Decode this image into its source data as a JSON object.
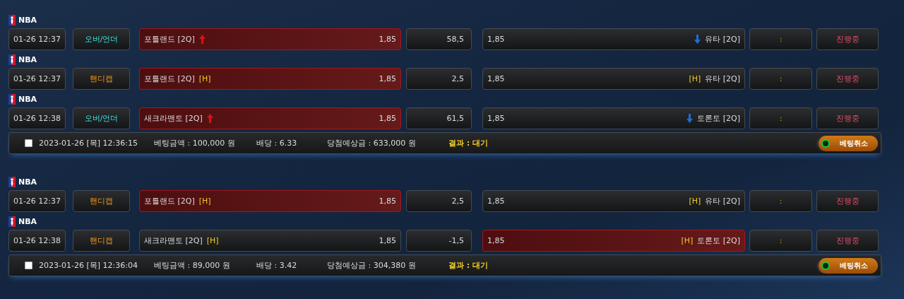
{
  "bets": [
    {
      "games": [
        {
          "league": "NBA",
          "time": "01-26 12:37",
          "type": {
            "kind": "over_under",
            "label": "오버/언더"
          },
          "home": {
            "kind": "rising",
            "name": "포틀랜드 [2Q]",
            "odds": "1,85",
            "selected": true
          },
          "line": "58,5",
          "away": {
            "kind": "falling",
            "odds": "1,85",
            "name": "유타 [2Q]",
            "selected": false
          },
          "score": ":",
          "status": "진행중"
        },
        {
          "league": "NBA",
          "time": "01-26 12:37",
          "type": {
            "kind": "handicap",
            "label": "핸디캡"
          },
          "home": {
            "name": "포틀랜드 [2Q]",
            "tag": "[H]",
            "odds": "1,85",
            "selected": true
          },
          "line": "2,5",
          "away": {
            "odds": "1,85",
            "tag": "[H]",
            "name": "유타 [2Q]",
            "selected": false
          },
          "score": ":",
          "status": "진행중"
        },
        {
          "league": "NBA",
          "time": "01-26 12:38",
          "type": {
            "kind": "over_under",
            "label": "오버/언더"
          },
          "home": {
            "kind": "rising",
            "name": "새크라맨토 [2Q]",
            "odds": "1,85",
            "selected": true
          },
          "line": "61,5",
          "away": {
            "kind": "falling",
            "odds": "1,85",
            "name": "토론토 [2Q]",
            "selected": false
          },
          "score": ":",
          "status": "진행중"
        }
      ],
      "summary": {
        "checked": false,
        "datetime": "2023-01-26 [목] 12:36:15",
        "amount": "베팅금액 : 100,000 원",
        "odds": "배당 : 6.33",
        "payout": "당첨예상금 : 633,000 원",
        "result": "결과 : 대기",
        "cancel": "베팅취소"
      }
    },
    {
      "games": [
        {
          "league": "NBA",
          "time": "01-26 12:37",
          "type": {
            "kind": "handicap",
            "label": "핸디캡"
          },
          "home": {
            "name": "포틀랜드 [2Q]",
            "tag": "[H]",
            "odds": "1,85",
            "selected": true
          },
          "line": "2,5",
          "away": {
            "odds": "1,85",
            "tag": "[H]",
            "name": "유타 [2Q]",
            "selected": false
          },
          "score": ":",
          "status": "진행중"
        },
        {
          "league": "NBA",
          "time": "01-26 12:38",
          "type": {
            "kind": "handicap",
            "label": "핸디캡"
          },
          "home": {
            "name": "새크라맨토 [2Q]",
            "tag": "[H]",
            "odds": "1,85",
            "selected": false
          },
          "line": "-1,5",
          "away": {
            "odds": "1,85",
            "tag": "[H]",
            "name": "토론토 [2Q]",
            "selected": true
          },
          "score": ":",
          "status": "진행중"
        }
      ],
      "summary": {
        "checked": false,
        "datetime": "2023-01-26 [목] 12:36:04",
        "amount": "베팅금액 : 89,000 원",
        "odds": "배당 : 3.42",
        "payout": "당첨예상금 : 304,380 원",
        "result": "결과 : 대기",
        "cancel": "베팅취소"
      }
    }
  ]
}
